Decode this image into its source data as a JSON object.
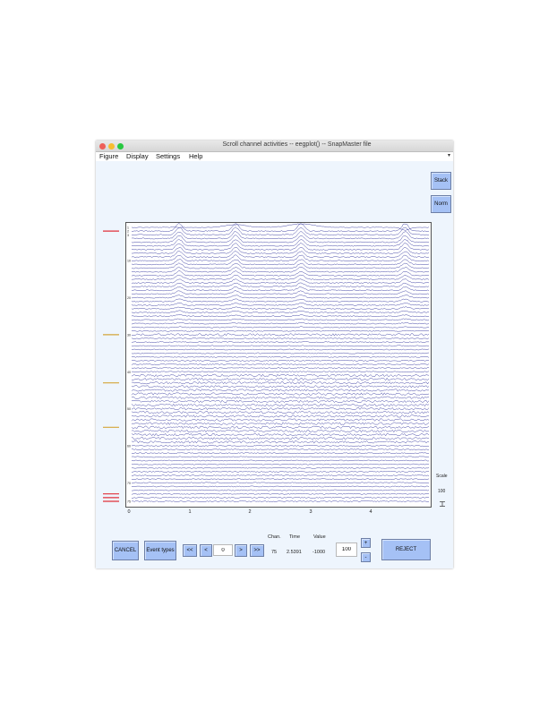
{
  "window": {
    "title": "Scroll channel activities -- eegplot() -- SnapMaster file"
  },
  "menu": {
    "items": [
      "Figure",
      "Display",
      "Settings",
      "Help"
    ],
    "overflow_icon": "menu-arrow-icon"
  },
  "buttons": {
    "stack": "Stack",
    "norm": "Norm",
    "cancel": "CANCEL",
    "event_types": "Event types",
    "first": "<<",
    "prev": "<",
    "next": ">",
    "last": ">>",
    "scale_up": "+",
    "scale_down": "-",
    "reject": "REJECT"
  },
  "navigation": {
    "position_value": "0"
  },
  "scale": {
    "label": "Scale",
    "value": "100",
    "input_value": "100"
  },
  "info": {
    "headers": {
      "chan": "Chan.",
      "time": "Time",
      "value": "Value"
    },
    "values": {
      "chan": "75",
      "time": "2.5391",
      "value": "-1000"
    }
  },
  "chart_data": {
    "type": "line",
    "description_type": "stacked EEG channel traces",
    "channel_count": 75,
    "channel_labels_partial": [
      "1",
      "2",
      "3",
      "10",
      "20",
      "30",
      "40",
      "50",
      "60",
      "70",
      "75"
    ],
    "xlim": [
      0,
      5
    ],
    "x_ticks": [
      "0",
      "1",
      "2",
      "3",
      "4"
    ],
    "grid": false,
    "trace_color": "#2b2f9a",
    "rejection_markers": [
      {
        "channel": 2,
        "color": "#e0303a"
      },
      {
        "channel": 30,
        "color": "#d4a53a"
      },
      {
        "channel": 43,
        "color": "#d4a53a"
      },
      {
        "channel": 55,
        "color": "#d4a53a"
      },
      {
        "channel": 73,
        "color": "#e0303a"
      },
      {
        "channel": 74,
        "color": "#e0303a"
      },
      {
        "channel": 75,
        "color": "#e0303a"
      }
    ],
    "artifacts_at_seconds": [
      0.8,
      1.75,
      2.85,
      4.6
    ]
  },
  "colors": {
    "button_bg": "#a5c1f5",
    "window_bg": "#eef5fd",
    "trace": "#2b2f9a"
  }
}
